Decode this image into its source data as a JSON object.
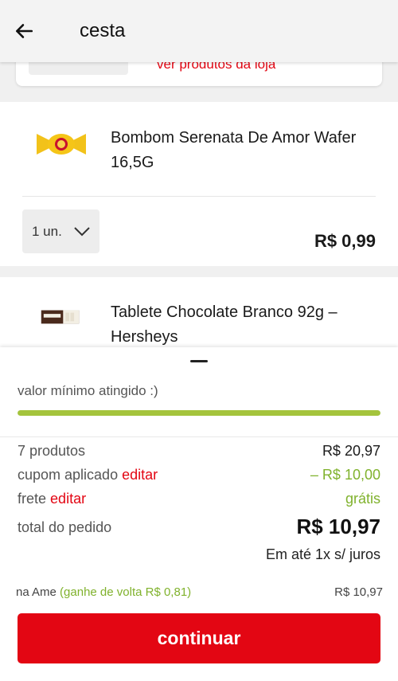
{
  "header": {
    "title": "cesta",
    "back_icon": "arrow-left-icon"
  },
  "store": {
    "link_text": "ver produtos da loja"
  },
  "products": [
    {
      "name": "Bombom Serenata De Amor Wafer 16,5G",
      "quantity": "1 un.",
      "price": "R$ 0,99",
      "image": "bombom-wrapper-icon"
    },
    {
      "name": "Tablete Chocolate Branco 92g – Hersheys",
      "image": "hersheys-bar-icon"
    }
  ],
  "summary": {
    "min_text": "valor mínimo atingido :)",
    "progress_fraction": 1.0,
    "products_label": "7 produtos",
    "products_value": "R$ 20,97",
    "coupon_label": "cupom aplicado",
    "coupon_edit": "editar",
    "coupon_value": "– R$ 10,00",
    "shipping_label": "frete",
    "shipping_edit": "editar",
    "shipping_value": "grátis",
    "total_label": "total do pedido",
    "total_value": "R$ 10,97",
    "installments": "Em até 1x s/ juros",
    "ame_prefix": "na Ame",
    "ame_cashback": "(ganhe de volta R$ 0,81)",
    "ame_value": "R$ 10,97",
    "continue_label": "continuar"
  },
  "colors": {
    "brand_red": "#e30613",
    "green": "#80b22d",
    "progress": "#a4c43c"
  }
}
